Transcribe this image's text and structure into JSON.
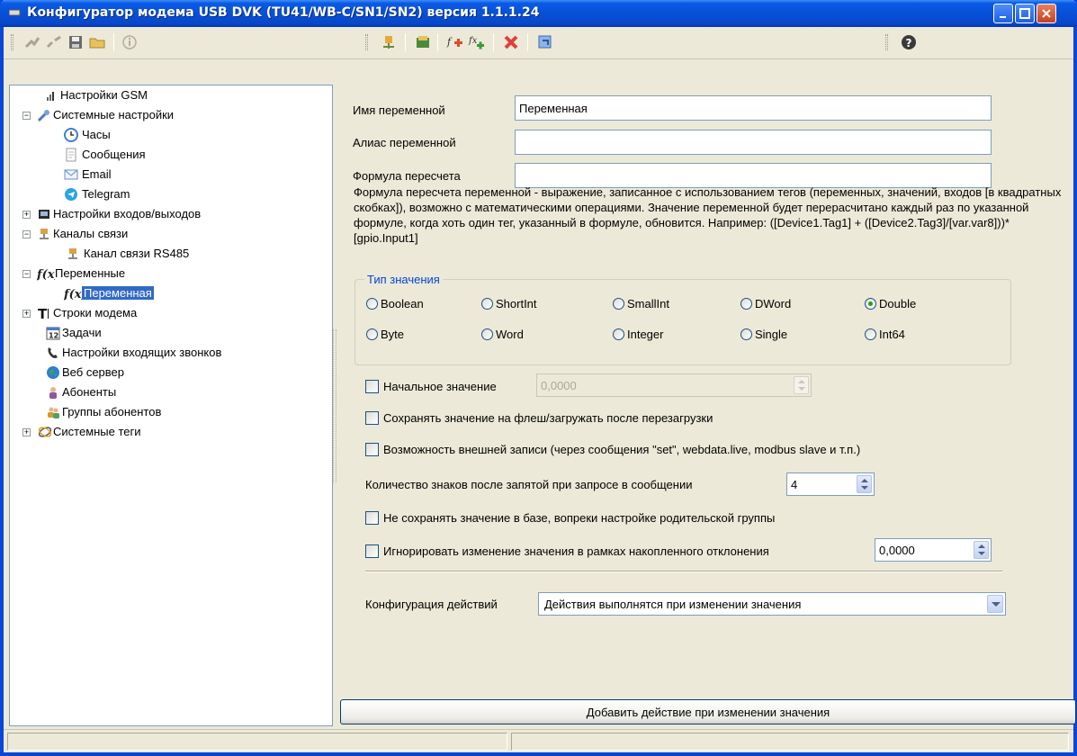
{
  "window": {
    "title": "Конфигуратор модема USB DVK (TU41/WB-C/SN1/SN2)  версия 1.1.1.24"
  },
  "tree": {
    "items": [
      {
        "label": "Настройки GSM",
        "icon": "signal-bars-icon"
      },
      {
        "label": "Системные настройки",
        "icon": "wrench-icon",
        "expanded": true
      },
      {
        "label": "Часы",
        "icon": "clock-icon"
      },
      {
        "label": "Сообщения",
        "icon": "document-icon"
      },
      {
        "label": "Email",
        "icon": "envelope-icon"
      },
      {
        "label": "Telegram",
        "icon": "telegram-icon"
      },
      {
        "label": "Настройки входов/выходов",
        "icon": "chip-icon",
        "expanded": false
      },
      {
        "label": "Каналы связи",
        "icon": "plug-icon",
        "expanded": true
      },
      {
        "label": "Канал связи RS485",
        "icon": "plug-icon"
      },
      {
        "label": "Переменные",
        "icon": "function-icon",
        "expanded": true
      },
      {
        "label": "Переменная",
        "icon": "function-icon",
        "selected": true
      },
      {
        "label": "Строки модема",
        "icon": "text-cursor-icon",
        "expanded": false
      },
      {
        "label": "Задачи",
        "icon": "calendar-icon"
      },
      {
        "label": "Настройки входящих звонков",
        "icon": "phone-icon"
      },
      {
        "label": "Веб сервер",
        "icon": "globe-icon"
      },
      {
        "label": "Абоненты",
        "icon": "user-icon"
      },
      {
        "label": "Группы абонентов",
        "icon": "users-icon"
      },
      {
        "label": "Системные теги",
        "icon": "tags-icon",
        "expanded": false
      }
    ]
  },
  "form": {
    "name_label": "Имя переменной",
    "name_value": "Переменная",
    "alias_label": "Алиас переменной",
    "alias_value": "",
    "formula_label": "Формула пересчета",
    "formula_value": "",
    "description": "Формула пересчета переменной - выражение, записанное с использованием тегов (переменных, значений, входов [в квадратных скобках]), возможно с математическими операциями. Значение переменной будет перерасчитано каждый раз по указанной формуле, когда хоть один тег, указанный в формуле, обновится. Например: ([Device1.Tag1] + ([Device2.Tag3]/[var.var8]))*[gpio.Input1]",
    "value_type_title": "Тип значения",
    "value_types": [
      "Boolean",
      "ShortInt",
      "SmallInt",
      "DWord",
      "Double",
      "Byte",
      "Word",
      "Integer",
      "Single",
      "Int64"
    ],
    "selected_type": "Double",
    "initial_value_label": "Начальное значение",
    "initial_value": "0,0000",
    "save_flash_label": "Сохранять значение на флеш/загружать после перезагрузки",
    "external_write_label": "Возможность внешней записи (через сообщения \"set\", webdata.live, modbus slave и т.п.)",
    "decimals_label": "Количество знаков после запятой при запросе в сообщении",
    "decimals_value": "4",
    "no_db_label": "Не сохранять значение в базе, вопреки настройке родительской группы",
    "ignore_label": "Игнорировать изменение значения в рамках накопленного отклонения",
    "ignore_value": "0,0000",
    "actions_label": "Конфигурация действий",
    "actions_value": "Действия выполнятся при изменении значения",
    "add_action_button": "Добавить действие при изменении значения"
  },
  "colors": {
    "titlebar": "#0850d8",
    "selection": "#316ac5",
    "groupbox_title": "#0046d5",
    "radio_dot": "#21a121"
  }
}
